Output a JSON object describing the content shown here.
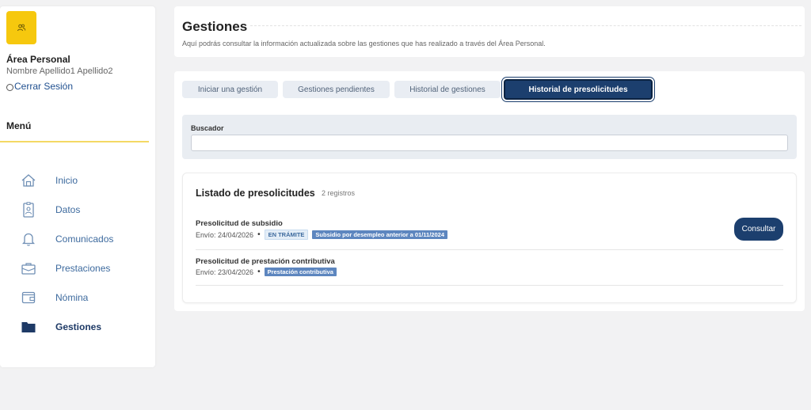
{
  "sidebar": {
    "avatar_icon": "users-icon",
    "area_title": "Área Personal",
    "user_name": "Nombre Apellido1 Apellido2",
    "logout_label": "Cerrar Sesión",
    "menu_title": "Menú",
    "items": [
      {
        "label": "Inicio",
        "icon": "home-icon",
        "active": false
      },
      {
        "label": "Datos",
        "icon": "id-badge-icon",
        "active": false
      },
      {
        "label": "Comunicados",
        "icon": "bell-icon",
        "active": false
      },
      {
        "label": "Prestaciones",
        "icon": "briefcase-icon",
        "active": false
      },
      {
        "label": "Nómina",
        "icon": "wallet-icon",
        "active": false
      },
      {
        "label": "Gestiones",
        "icon": "folder-icon",
        "active": true
      }
    ]
  },
  "header": {
    "title": "Gestiones",
    "subtitle": "Aquí podrás consultar la información actualizada sobre las gestiones que has realizado a través del Área Personal."
  },
  "tabs": [
    {
      "label": "Iniciar una gestión",
      "active": false
    },
    {
      "label": "Gestiones pendientes",
      "active": false
    },
    {
      "label": "Historial de gestiones",
      "active": false
    },
    {
      "label": "Historial de presolicitudes",
      "active": true
    }
  ],
  "search": {
    "label": "Buscador",
    "value": "",
    "placeholder": ""
  },
  "list": {
    "title": "Listado de presolicitudes",
    "count": "2 registros",
    "rows": [
      {
        "title": "Presolicitud de subsidio",
        "date": "Envío: 24/04/2026",
        "status_badge": "EN TRÁMITE",
        "info_badge": "Subsidio por desempleo anterior a 01/11/2024",
        "action_label": "Consultar"
      },
      {
        "title": "Presolicitud de prestación contributiva",
        "date": "Envío: 23/04/2026",
        "info_badge": "Prestación contributiva"
      }
    ]
  },
  "colors": {
    "primary": "#1c3f6e",
    "accent_yellow": "#f6c80e",
    "nav_text": "#3d6a9e",
    "badge_blue": "#5d86bf"
  }
}
